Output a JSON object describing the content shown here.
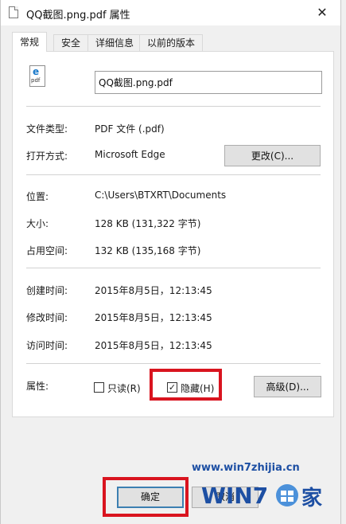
{
  "window": {
    "title": "QQ截图.png.pdf 属性",
    "close_glyph": "✕"
  },
  "tabs": [
    {
      "label": "常规",
      "active": true
    },
    {
      "label": "安全",
      "active": false
    },
    {
      "label": "详细信息",
      "active": false
    },
    {
      "label": "以前的版本",
      "active": false
    }
  ],
  "file": {
    "name": "QQ截图.png.pdf",
    "icon": "pdf-edge-file-icon",
    "icon_letter": "e",
    "icon_caption": "pdf"
  },
  "type_section": {
    "file_type_label": "文件类型:",
    "file_type_value": "PDF 文件 (.pdf)",
    "opens_with_label": "打开方式:",
    "opens_with_value": "Microsoft Edge",
    "change_button": "更改(C)..."
  },
  "location_section": {
    "location_label": "位置:",
    "location_value": "C:\\Users\\BTXRT\\Documents",
    "size_label": "大小:",
    "size_value": "128 KB (131,322 字节)",
    "size_on_disk_label": "占用空间:",
    "size_on_disk_value": "132 KB (135,168 字节)"
  },
  "time_section": {
    "created_label": "创建时间:",
    "created_value": "2015年8月5日，12:13:45",
    "modified_label": "修改时间:",
    "modified_value": "2015年8月5日，12:13:45",
    "accessed_label": "访问时间:",
    "accessed_value": "2015年8月5日，12:13:45"
  },
  "attributes": {
    "label": "属性:",
    "readonly_label": "只读(R)",
    "readonly_checked": false,
    "hidden_label": "隐藏(H)",
    "hidden_checked": true,
    "check_glyph": "✓",
    "advanced_button": "高级(D)..."
  },
  "footer": {
    "ok_button": "确定",
    "cancel_button": "取消"
  },
  "watermark": {
    "url": "www.win7zhijia.cn",
    "logo_text": "WIN7",
    "logo_suffix": "家"
  },
  "colors": {
    "highlight": "#d9141f",
    "accent": "#3c7fb1",
    "watermark": "#1d4fa3"
  }
}
